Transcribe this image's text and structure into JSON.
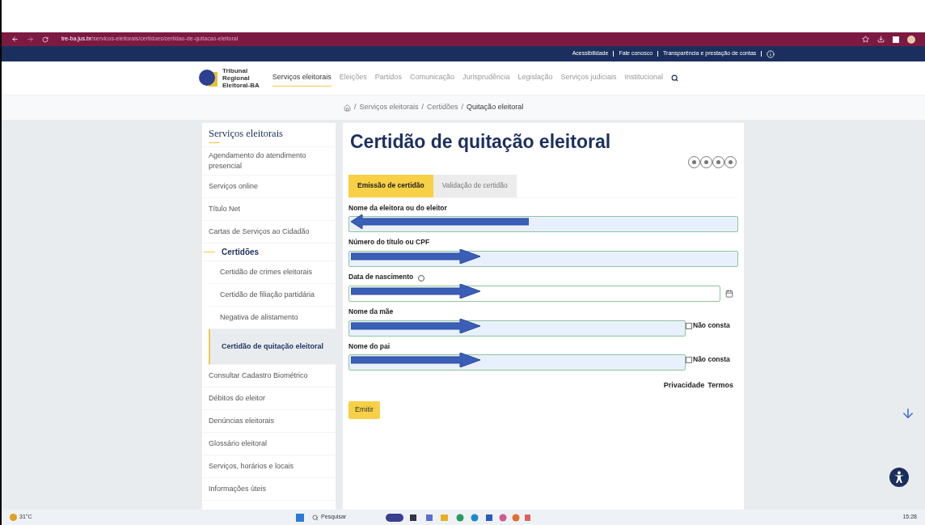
{
  "browser": {
    "url_host": "tre-ba.jus.br",
    "url_path": "/servicos-eleitorais/certidoes/certidao-de-quitacao-eleitoral"
  },
  "top_links": [
    "Acessibilidade",
    "Fale conosco",
    "Transparência e prestação de contas"
  ],
  "logo_lines": [
    "Tribunal",
    "Regional",
    "Eleitoral-BA"
  ],
  "nav": [
    {
      "label": "Serviços eleitorais",
      "selected": true
    },
    {
      "label": "Eleições",
      "selected": false
    },
    {
      "label": "Partidos",
      "selected": false
    },
    {
      "label": "Comunicação",
      "selected": false
    },
    {
      "label": "Jurisprudência",
      "selected": false
    },
    {
      "label": "Legislação",
      "selected": false
    },
    {
      "label": "Serviços judiciais",
      "selected": false
    },
    {
      "label": "Institucional",
      "selected": false
    }
  ],
  "breadcrumb": {
    "separator": "/",
    "items": [
      "Serviços eleitorais",
      "Certidões",
      "Quitação eleitoral"
    ]
  },
  "sidebar": {
    "title": "Serviços eleitorais",
    "items": [
      {
        "label": "Agendamento do atendimento presencial",
        "selected": false
      },
      {
        "label": "Serviços online",
        "selected": false
      },
      {
        "label": "Título Net",
        "selected": false
      },
      {
        "label": "Cartas de Serviços ao Cidadão",
        "selected": false
      },
      {
        "label": "Certidões",
        "children": [
          {
            "label": "Certidão de crimes eleitorais",
            "selected": false
          },
          {
            "label": "Certidão de filiação partidária",
            "selected": false
          },
          {
            "label": "Negativa de alistamento",
            "selected": false
          },
          {
            "label": "Certidão de quitação eleitoral",
            "selected": true
          }
        ]
      },
      {
        "label": "Consultar Cadastro Biométrico",
        "selected": false
      },
      {
        "label": "Débitos do eleitor",
        "selected": false
      },
      {
        "label": "Denúncias eleitorais",
        "selected": false
      },
      {
        "label": "Glossário eleitoral",
        "selected": false
      },
      {
        "label": "Serviços, horários e locais",
        "selected": false
      },
      {
        "label": "Informações úteis",
        "selected": false
      }
    ]
  },
  "page_title": "Certidão de quitação eleitoral",
  "tabs": [
    {
      "label": "Emissão de certidão",
      "selected": true
    },
    {
      "label": "Validação de certidão",
      "selected": false
    }
  ],
  "fields": [
    {
      "kind": "text",
      "label": "Nome da eleitora ou do eleitor",
      "arrow_points_left": true
    },
    {
      "kind": "text",
      "label": "Número do título ou CPF",
      "arrow_points_left": false
    },
    {
      "kind": "date",
      "label": "Data de nascimento",
      "arrow_points_left": false
    },
    {
      "kind": "optional",
      "label": "Nome da mãe",
      "arrow_points_left": false,
      "checkbox_label": "Não consta",
      "checked": false
    },
    {
      "kind": "optional",
      "label": "Nome do pai",
      "arrow_points_left": false,
      "checkbox_label": "Não consta",
      "checked": false
    }
  ],
  "recaptcha_links": [
    "Privacidade",
    "Termos"
  ],
  "submit": "Emitir",
  "taskbar": {
    "temperature": "31°C",
    "search_placeholder": "Pesquisar",
    "time": "15:28"
  }
}
